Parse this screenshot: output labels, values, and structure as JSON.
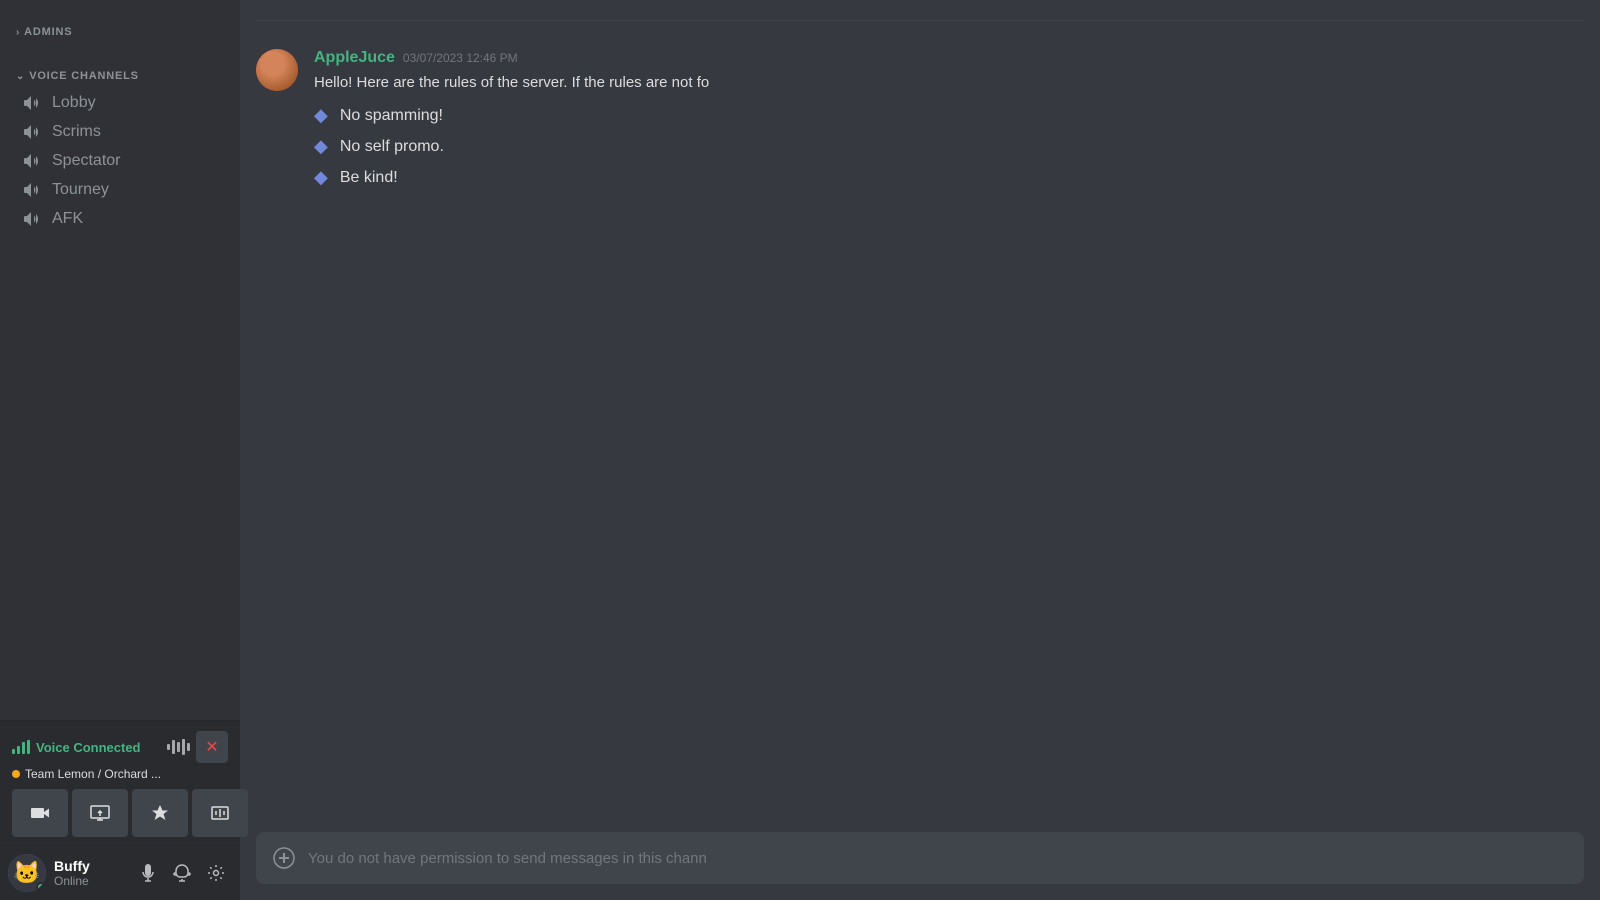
{
  "sidebar": {
    "sections": [
      {
        "id": "admins",
        "label": "ADMINS",
        "collapsed": true,
        "chevron": "›"
      },
      {
        "id": "voice-channels",
        "label": "VOICE CHANNELS",
        "collapsed": false,
        "chevron": "⌄"
      }
    ],
    "channels": [
      {
        "id": "lobby",
        "name": "Lobby",
        "type": "voice"
      },
      {
        "id": "scrims",
        "name": "Scrims",
        "type": "voice"
      },
      {
        "id": "spectator",
        "name": "Spectator",
        "type": "voice"
      },
      {
        "id": "tourney",
        "name": "Tourney",
        "type": "voice"
      },
      {
        "id": "afk",
        "name": "AFK",
        "type": "voice"
      }
    ]
  },
  "voice_connected": {
    "title": "Voice Connected",
    "subtitle": "Team Lemon / Orchard ...",
    "buttons": [
      "camera",
      "screen",
      "activity",
      "soundboard"
    ]
  },
  "user_panel": {
    "username": "Buffy",
    "status": "Online",
    "avatar_emoji": "🐱"
  },
  "message": {
    "author": "AppleJuce",
    "timestamp": "03/07/2023 12:46 PM",
    "intro": "Hello! Here are the rules of the server. If the rules are not fo",
    "rules": [
      "No spamming!",
      "No self promo.",
      "Be kind!"
    ]
  },
  "input": {
    "placeholder": "You do not have permission to send messages in this chann"
  },
  "icons": {
    "speaker": "🔊",
    "camera": "📷",
    "screen": "🖥",
    "activity": "🚀",
    "soundboard": "🎵",
    "microphone": "🎤",
    "headphone": "🎧",
    "gear": "⚙",
    "add": "➕",
    "diamond": "◆",
    "disconnect": "✖"
  }
}
